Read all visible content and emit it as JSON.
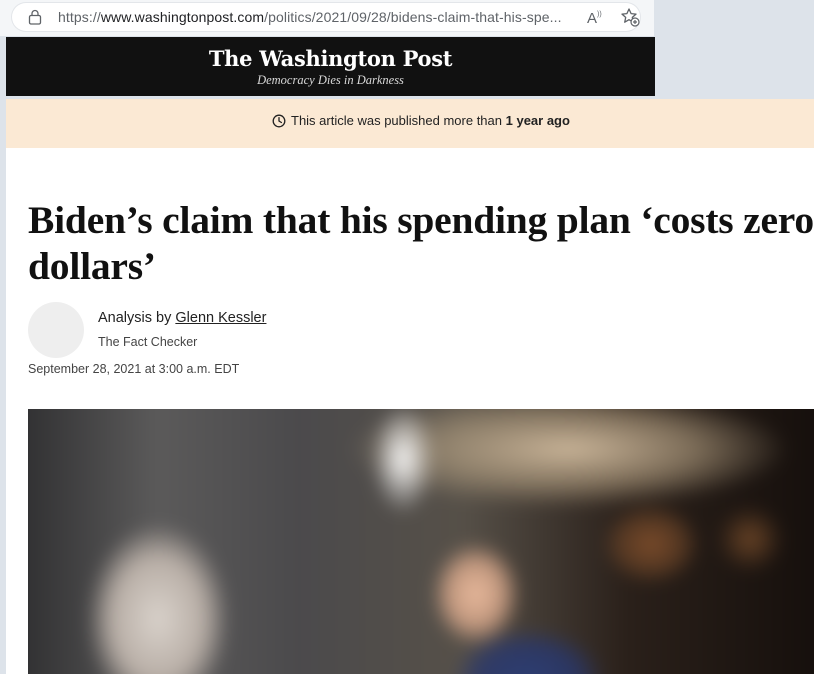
{
  "browser": {
    "url_prefix": "https://",
    "url_host": "www.washingtonpost.com",
    "url_path": "/politics/2021/09/28/bidens-claim-that-his-spe...",
    "read_aloud_label": "A",
    "read_aloud_super": "))"
  },
  "masthead": {
    "logo": "The Washington Post",
    "tagline": "Democracy Dies in Darkness"
  },
  "notice": {
    "text": "This article was published more than",
    "emphasis": "1 year ago"
  },
  "article": {
    "headline": "Biden’s claim that his spending plan ‘costs zero dollars’",
    "byline_prefix": "Analysis by",
    "author": "Glenn Kessler",
    "column": "The Fact Checker",
    "date": "September 28, 2021 at 3:00 a.m. EDT"
  }
}
